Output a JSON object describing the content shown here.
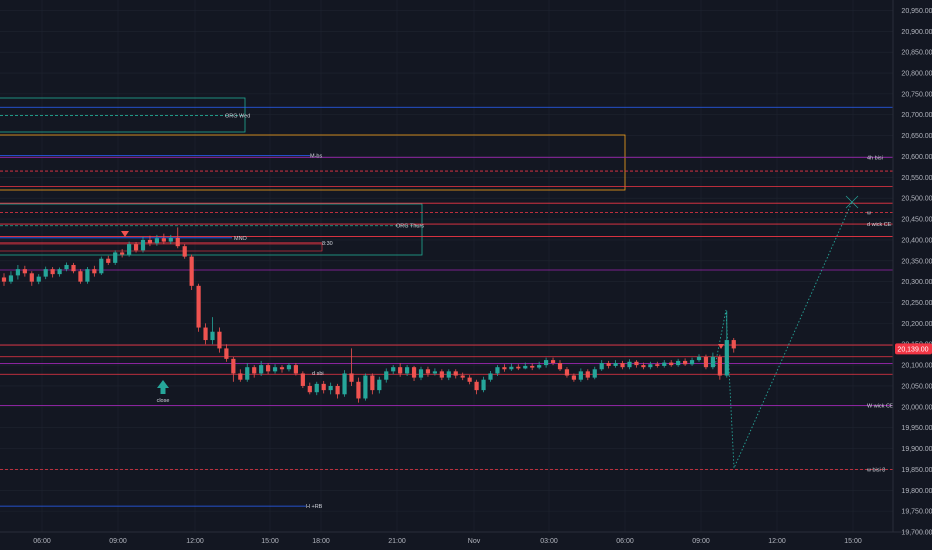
{
  "colors": {
    "background": "#131722",
    "grid": "#1f2430",
    "up": "#26a69a",
    "down": "#ef5350",
    "red_line": "#f23645",
    "purple_line": "#9c27b0",
    "blue_line": "#2962ff",
    "orange_box": "#f7a21b",
    "teal_box": "#22ab94",
    "arrow": "#26a69a",
    "price_badge": "#f23645"
  },
  "current_price_label": "20,139.00",
  "chart_data": {
    "type": "candlestick",
    "ylim": [
      19700,
      20975
    ],
    "y_ticks": [
      "20,950.00",
      "20,900.00",
      "20,850.00",
      "20,800.00",
      "20,750.00",
      "20,700.00",
      "20,650.00",
      "20,600.00",
      "20,550.00",
      "20,500.00",
      "20,450.00",
      "20,400.00",
      "20,350.00",
      "20,300.00",
      "20,250.00",
      "20,200.00",
      "20,150.00",
      "20,100.00",
      "20,050.00",
      "20,000.00",
      "19,950.00",
      "19,900.00",
      "19,850.00",
      "19,800.00",
      "19,750.00",
      "19,700.00"
    ],
    "y_tick_values": [
      20950,
      20900,
      20850,
      20800,
      20750,
      20700,
      20650,
      20600,
      20550,
      20500,
      20450,
      20400,
      20350,
      20300,
      20250,
      20200,
      20150,
      20100,
      20050,
      20000,
      19950,
      19900,
      19850,
      19800,
      19750,
      19700
    ],
    "x_ticks": [
      "06:00",
      "09:00",
      "12:00",
      "15:00",
      "18:00",
      "21:00",
      "Nov",
      "03:00",
      "06:00",
      "09:00",
      "12:00",
      "15:00"
    ],
    "candles": [
      [
        20310,
        20300,
        20320,
        20290
      ],
      [
        20300,
        20315,
        20325,
        20295
      ],
      [
        20315,
        20330,
        20340,
        20305
      ],
      [
        20330,
        20320,
        20338,
        20312
      ],
      [
        20320,
        20300,
        20325,
        20290
      ],
      [
        20300,
        20312,
        20318,
        20294
      ],
      [
        20312,
        20330,
        20336,
        20306
      ],
      [
        20330,
        20318,
        20335,
        20310
      ],
      [
        20318,
        20330,
        20334,
        20312
      ],
      [
        20330,
        20340,
        20346,
        20325
      ],
      [
        20340,
        20325,
        20345,
        20320
      ],
      [
        20325,
        20300,
        20330,
        20295
      ],
      [
        20300,
        20330,
        20335,
        20295
      ],
      [
        20330,
        20320,
        20338,
        20312
      ],
      [
        20320,
        20355,
        20360,
        20316
      ],
      [
        20355,
        20345,
        20362,
        20340
      ],
      [
        20345,
        20370,
        20375,
        20340
      ],
      [
        20370,
        20365,
        20378,
        20358
      ],
      [
        20365,
        20390,
        20396,
        20360
      ],
      [
        20390,
        20375,
        20395,
        20370
      ],
      [
        20375,
        20400,
        20408,
        20370
      ],
      [
        20400,
        20392,
        20410,
        20385
      ],
      [
        20392,
        20404,
        20412,
        20386
      ],
      [
        20404,
        20396,
        20415,
        20390
      ],
      [
        20396,
        20405,
        20412,
        20390
      ],
      [
        20405,
        20385,
        20430,
        20380
      ],
      [
        20385,
        20360,
        20390,
        20355
      ],
      [
        20360,
        20290,
        20365,
        20280
      ],
      [
        20290,
        20190,
        20295,
        20180
      ],
      [
        20190,
        20160,
        20200,
        20150
      ],
      [
        20160,
        20180,
        20215,
        20150
      ],
      [
        20180,
        20140,
        20190,
        20130
      ],
      [
        20140,
        20115,
        20150,
        20108
      ],
      [
        20115,
        20080,
        20120,
        20060
      ],
      [
        20080,
        20065,
        20090,
        20060
      ],
      [
        20065,
        20095,
        20105,
        20060
      ],
      [
        20095,
        20080,
        20100,
        20070
      ],
      [
        20080,
        20100,
        20110,
        20074
      ],
      [
        20100,
        20085,
        20105,
        20078
      ],
      [
        20085,
        20095,
        20102,
        20080
      ],
      [
        20095,
        20090,
        20100,
        20082
      ],
      [
        20090,
        20100,
        20105,
        20085
      ],
      [
        20100,
        20080,
        20105,
        20075
      ],
      [
        20080,
        20050,
        20085,
        20045
      ],
      [
        20050,
        20035,
        20058,
        20030
      ],
      [
        20035,
        20055,
        20060,
        20028
      ],
      [
        20055,
        20040,
        20062,
        20032
      ],
      [
        20040,
        20050,
        20058,
        20030
      ],
      [
        20050,
        20030,
        20055,
        20020
      ],
      [
        20030,
        20080,
        20088,
        20024
      ],
      [
        20080,
        20060,
        20140,
        20050
      ],
      [
        20060,
        20020,
        20070,
        20010
      ],
      [
        20020,
        20075,
        20080,
        20015
      ],
      [
        20075,
        20040,
        20080,
        20030
      ],
      [
        20040,
        20065,
        20072,
        20032
      ],
      [
        20065,
        20085,
        20092,
        20058
      ],
      [
        20085,
        20095,
        20100,
        20078
      ],
      [
        20095,
        20080,
        20105,
        20072
      ],
      [
        20080,
        20095,
        20100,
        20074
      ],
      [
        20095,
        20070,
        20098,
        20062
      ],
      [
        20070,
        20090,
        20096,
        20064
      ],
      [
        20090,
        20080,
        20096,
        20072
      ],
      [
        20080,
        20085,
        20092,
        20075
      ],
      [
        20085,
        20070,
        20090,
        20064
      ],
      [
        20070,
        20085,
        20090,
        20064
      ],
      [
        20085,
        20075,
        20090,
        20068
      ],
      [
        20075,
        20070,
        20082,
        20064
      ],
      [
        20070,
        20060,
        20076,
        20054
      ],
      [
        20060,
        20040,
        20065,
        20030
      ],
      [
        20040,
        20065,
        20072,
        20035
      ],
      [
        20065,
        20080,
        20086,
        20060
      ],
      [
        20080,
        20095,
        20100,
        20074
      ],
      [
        20095,
        20090,
        20102,
        20084
      ],
      [
        20090,
        20096,
        20104,
        20086
      ],
      [
        20096,
        20092,
        20102,
        20088
      ],
      [
        20092,
        20098,
        20106,
        20090
      ],
      [
        20098,
        20094,
        20104,
        20088
      ],
      [
        20094,
        20100,
        20108,
        20090
      ],
      [
        20100,
        20112,
        20118,
        20094
      ],
      [
        20112,
        20105,
        20118,
        20100
      ],
      [
        20105,
        20090,
        20112,
        20086
      ],
      [
        20090,
        20075,
        20095,
        20070
      ],
      [
        20075,
        20065,
        20080,
        20060
      ],
      [
        20065,
        20085,
        20092,
        20060
      ],
      [
        20085,
        20070,
        20090,
        20064
      ],
      [
        20070,
        20090,
        20096,
        20066
      ],
      [
        20090,
        20105,
        20112,
        20086
      ],
      [
        20105,
        20098,
        20110,
        20092
      ],
      [
        20098,
        20105,
        20112,
        20094
      ],
      [
        20105,
        20095,
        20110,
        20090
      ],
      [
        20095,
        20108,
        20114,
        20090
      ],
      [
        20108,
        20100,
        20112,
        20094
      ],
      [
        20100,
        20095,
        20106,
        20090
      ],
      [
        20095,
        20102,
        20108,
        20090
      ],
      [
        20102,
        20098,
        20108,
        20094
      ],
      [
        20098,
        20106,
        20112,
        20094
      ],
      [
        20106,
        20100,
        20112,
        20096
      ],
      [
        20100,
        20110,
        20115,
        20096
      ],
      [
        20110,
        20102,
        20116,
        20098
      ],
      [
        20102,
        20112,
        20118,
        20098
      ],
      [
        20112,
        20120,
        20126,
        20108
      ],
      [
        20120,
        20095,
        20125,
        20090
      ],
      [
        20095,
        20120,
        20130,
        20090
      ],
      [
        20120,
        20075,
        20125,
        20065
      ],
      [
        20075,
        20160,
        20230,
        20070
      ],
      [
        20160,
        20140,
        20165,
        20130
      ]
    ],
    "levels": [
      {
        "value": 20718,
        "color": "blue_line",
        "x_start": 0.0,
        "x_end": 1.0,
        "style": "solid",
        "label": ""
      },
      {
        "value": 20598,
        "color": "purple_line",
        "x_start": 0.0,
        "x_end": 1.0,
        "style": "solid",
        "label": "4h bisi"
      },
      {
        "value": 20565,
        "color": "red_line",
        "x_start": 0.0,
        "x_end": 1.0,
        "style": "dashed",
        "label": ""
      },
      {
        "value": 20528,
        "color": "red_line",
        "x_start": 0.0,
        "x_end": 1.0,
        "style": "solid",
        "label": ""
      },
      {
        "value": 20488,
        "color": "red_line",
        "x_start": 0.0,
        "x_end": 1.0,
        "style": "solid",
        "label": ""
      },
      {
        "value": 20466,
        "color": "red_line",
        "x_start": 0.0,
        "x_end": 1.0,
        "style": "dashed",
        "label": "w"
      },
      {
        "value": 20438,
        "color": "red_line",
        "x_start": 0.0,
        "x_end": 1.0,
        "style": "solid",
        "label": "d wick CE"
      },
      {
        "value": 20408,
        "color": "red_line",
        "x_start": 0.0,
        "x_end": 1.0,
        "style": "solid",
        "label": ""
      },
      {
        "value": 20328,
        "color": "purple_line",
        "x_start": 0.0,
        "x_end": 1.0,
        "style": "solid",
        "label": ""
      },
      {
        "value": 20148,
        "color": "red_line",
        "x_start": 0.0,
        "x_end": 1.0,
        "style": "solid",
        "label": ""
      },
      {
        "value": 20120,
        "color": "red_line",
        "x_start": 0.0,
        "x_end": 1.0,
        "style": "solid",
        "label": ""
      },
      {
        "value": 20104,
        "color": "purple_line",
        "x_start": 0.0,
        "x_end": 1.0,
        "style": "solid",
        "label": ""
      },
      {
        "value": 20078,
        "color": "red_line",
        "x_start": 0.0,
        "x_end": 1.0,
        "style": "solid",
        "label": ""
      },
      {
        "value": 20003,
        "color": "purple_line",
        "x_start": 0.0,
        "x_end": 1.0,
        "style": "solid",
        "label": "W wick CE"
      },
      {
        "value": 19850,
        "color": "red_line",
        "x_start": 0.0,
        "x_end": 1.0,
        "style": "dashed",
        "label": "w bisi 8"
      }
    ],
    "short_levels": [
      {
        "value": 20698,
        "label": "ORG Wed",
        "color": "teal_box",
        "style": "dashed"
      },
      {
        "value": 20602,
        "label": "M-bs",
        "color": "blue_line",
        "style": "solid"
      },
      {
        "value": 20405,
        "label": "MNO",
        "color": "blue_line",
        "style": "solid"
      },
      {
        "value": 20393,
        "label": "8:30",
        "color": "red_line",
        "style": "solid"
      },
      {
        "value": 20434,
        "label": "ORG Thurs",
        "color": "teal_box",
        "style": "dashed"
      },
      {
        "value": 19762,
        "label": "H +RB",
        "color": "blue_line",
        "style": "solid"
      }
    ],
    "annotations": [
      {
        "text": "close",
        "value": 20022
      },
      {
        "text": "d sbi",
        "value": 20081
      }
    ]
  }
}
